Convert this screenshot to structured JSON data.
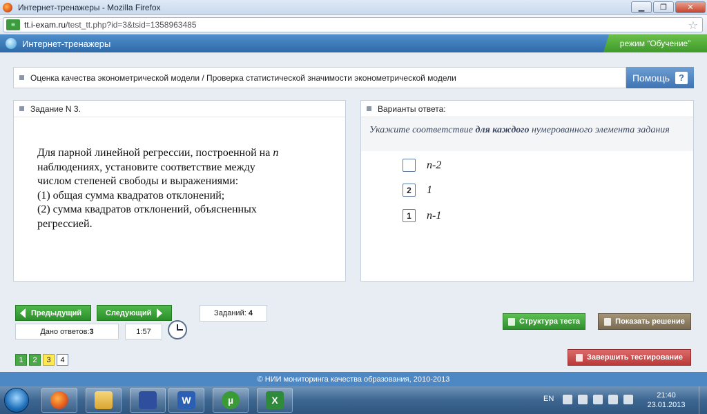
{
  "window": {
    "title": "Интернет-тренажеры - Mozilla Firefox"
  },
  "browser": {
    "url_host": "tt.i-exam.ru",
    "url_path": "/test_tt.php?id=3&tsid=1358963485"
  },
  "app": {
    "title": "Интернет-тренажеры",
    "mode": "режим “Обучение”"
  },
  "breadcrumb": "Оценка качества эконометрической модели / Проверка статистической значимости эконометрической модели",
  "help_label": "Помощь",
  "task": {
    "header": "Задание N 3.",
    "lines": [
      "Для парной линейной регрессии, построенной на",
      "наблюдениях, установите соответствие между",
      "числом степеней свободы и выражениями:",
      "(1) общая сумма квадратов отклонений;",
      "(2) сумма квадратов отклонений, объясненных",
      "регрессией."
    ],
    "n_var": "n"
  },
  "answers": {
    "header": "Варианты ответа:",
    "hint_pre": "Укажите соответствие ",
    "hint_bold": "для каждого",
    "hint_post": " нумерованного элемента задания",
    "options": [
      {
        "box": "",
        "label": "n-2"
      },
      {
        "box": "2",
        "label": "1"
      },
      {
        "box": "1",
        "label": "n-1"
      }
    ]
  },
  "nav": {
    "prev_label": "Предыдущий",
    "next_label": "Следующий",
    "tasks_label": "Заданий:",
    "tasks_count": "4",
    "answered_label": "Дано ответов:",
    "answered_count": "3",
    "timer": "1:57"
  },
  "actions": {
    "structure_label": "Структура теста",
    "solution_label": "Показать решение",
    "finish_label": "Завершить тестирование"
  },
  "pages": [
    "1",
    "2",
    "3",
    "4"
  ],
  "footer": "© НИИ мониторинга качества образования, 2010-2013",
  "taskbar": {
    "lang": "EN",
    "time": "21:40",
    "date": "23.01.2013",
    "word_glyph": "W",
    "torrent_glyph": "µ",
    "excel_glyph": "X"
  },
  "colors": {
    "header_blue": "#2f6aa8",
    "mode_green": "#3e9a2b",
    "nav_green": "#2b8f2a",
    "solution_brown": "#8a7a60",
    "finish_red": "#c94a4a",
    "current_page": "#ffe94d"
  }
}
